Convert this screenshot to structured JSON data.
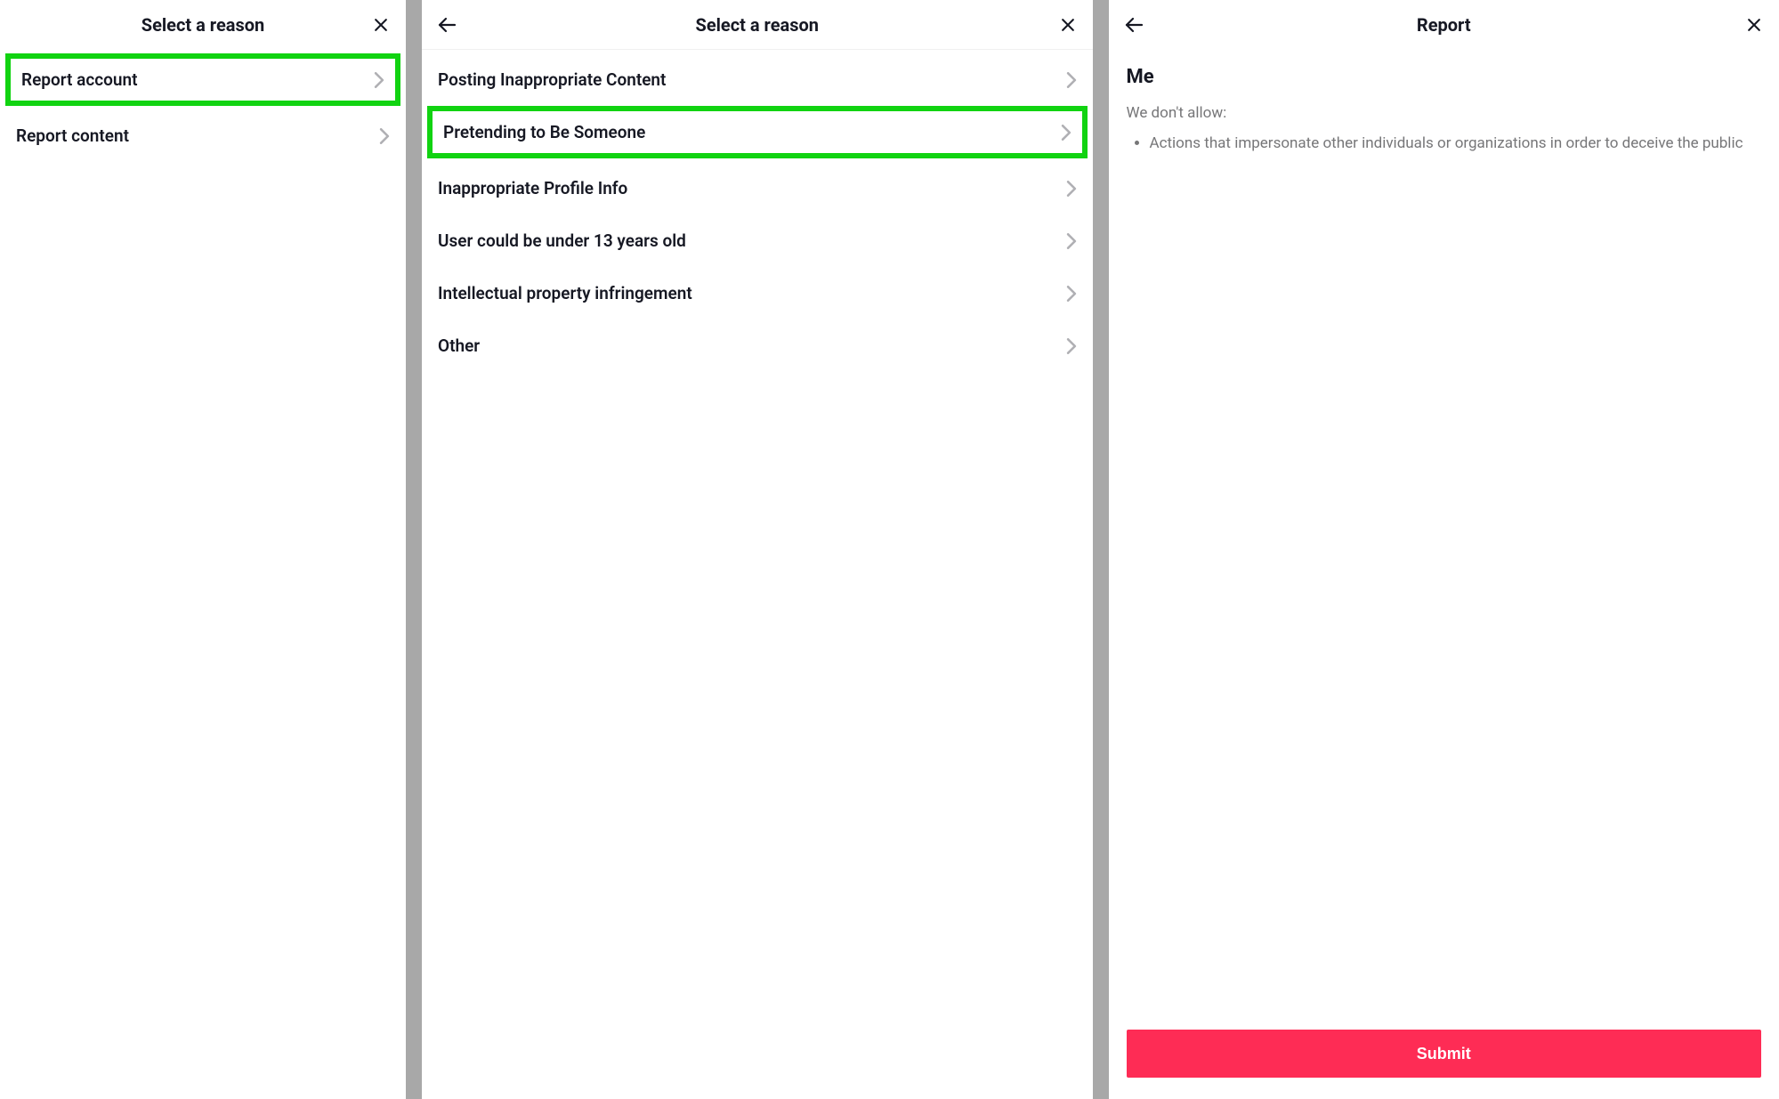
{
  "panel1": {
    "title": "Select a reason",
    "items": [
      {
        "label": "Report account"
      },
      {
        "label": "Report content"
      }
    ]
  },
  "panel2": {
    "title": "Select a reason",
    "items": [
      {
        "label": "Posting Inappropriate Content"
      },
      {
        "label": "Pretending to Be Someone"
      },
      {
        "label": "Inappropriate Profile Info"
      },
      {
        "label": "User could be under 13 years old"
      },
      {
        "label": "Intellectual property infringement"
      },
      {
        "label": "Other"
      }
    ]
  },
  "panel3": {
    "title": "Report",
    "section_title": "Me",
    "disallow_label": "We don't allow:",
    "bullets": [
      "Actions that impersonate other individuals or organizations in order to deceive the public"
    ],
    "submit_label": "Submit"
  }
}
